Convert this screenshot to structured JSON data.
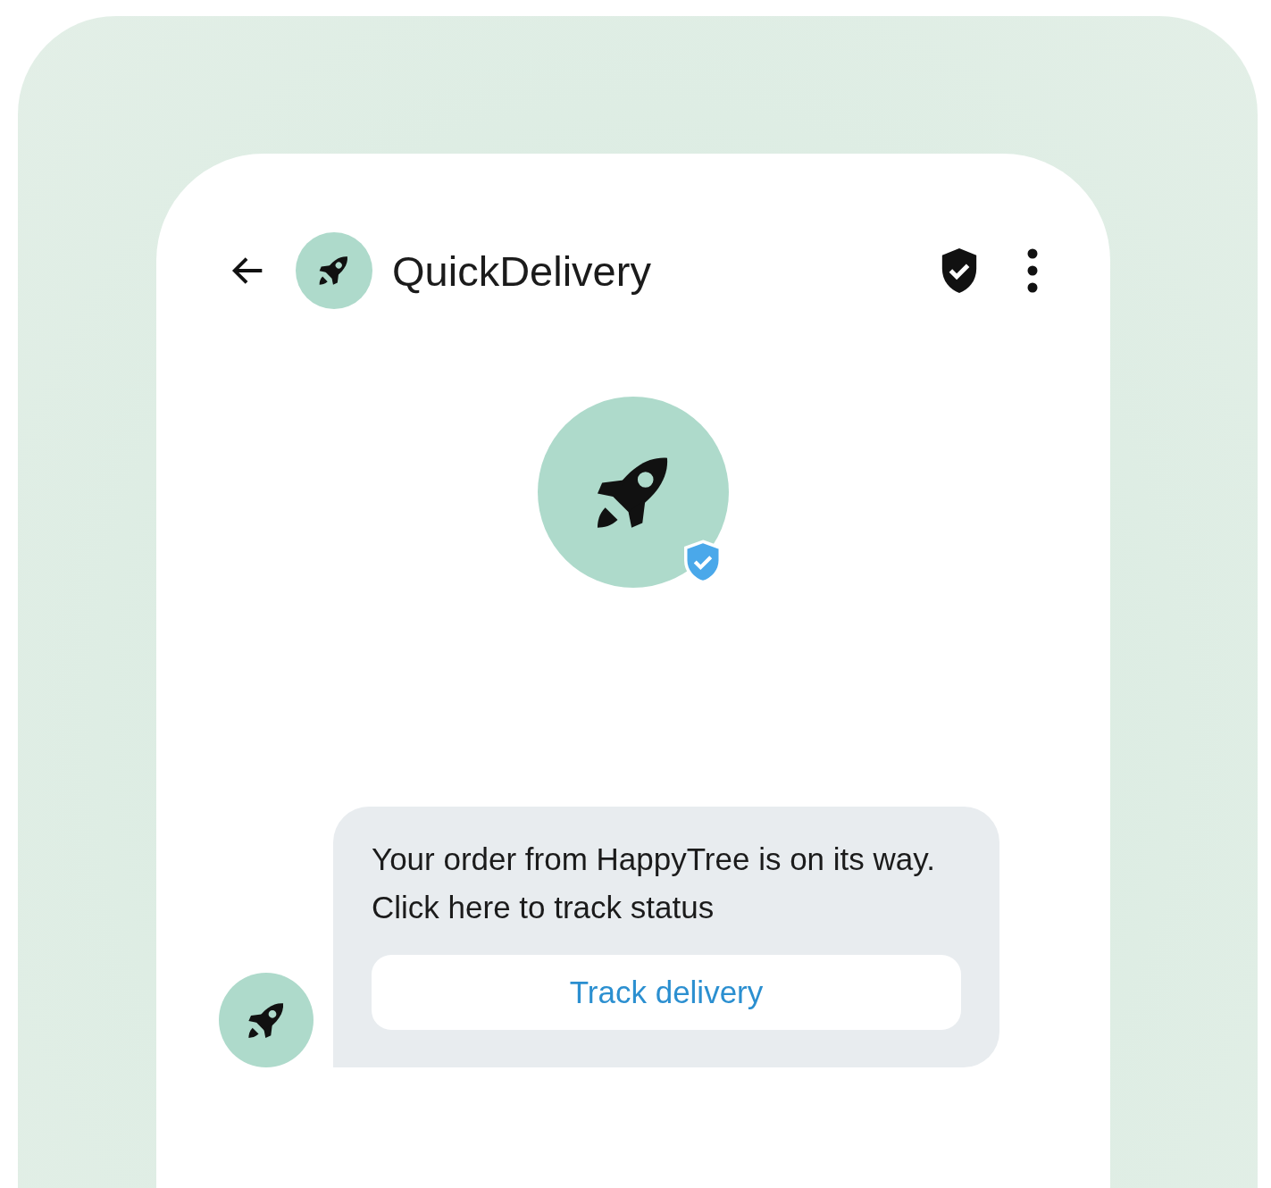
{
  "header": {
    "title": "QuickDelivery"
  },
  "message": {
    "text": "Your order from HappyTree is on its way. Click here to track status",
    "button": "Track delivery"
  }
}
